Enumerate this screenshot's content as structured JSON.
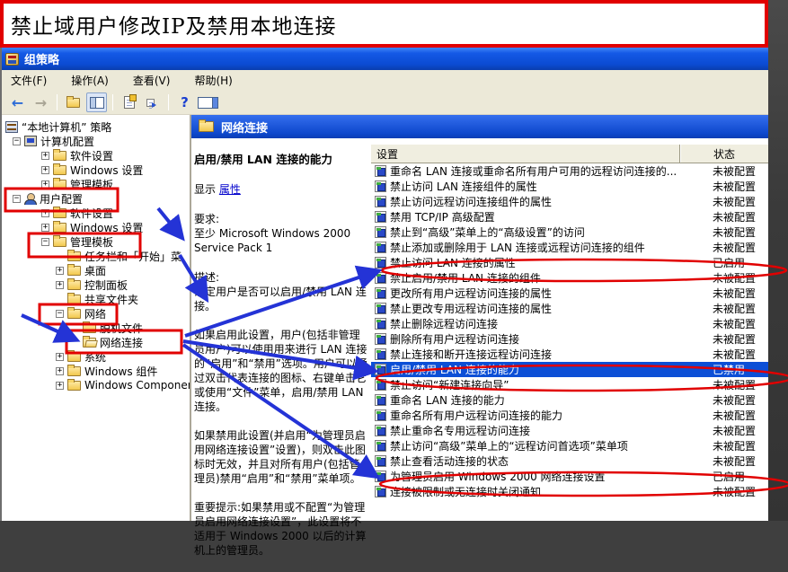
{
  "annotation_title": "禁止域用户修改IP及禁用本地连接",
  "window": {
    "title": "组策略",
    "menu": {
      "items": [
        {
          "label": "文件(F)"
        },
        {
          "label": "操作(A)"
        },
        {
          "label": "查看(V)"
        },
        {
          "label": "帮助(H)"
        }
      ]
    },
    "toolbar": {
      "icons": [
        {
          "name": "back-icon",
          "type": "back"
        },
        {
          "name": "forward-icon",
          "type": "fwd"
        },
        {
          "name": "separator",
          "type": "sep"
        },
        {
          "name": "up-one-level-icon",
          "type": "upfolder"
        },
        {
          "name": "show-console-tree-icon",
          "type": "panes",
          "pressed": true
        },
        {
          "name": "separator",
          "type": "sep"
        },
        {
          "name": "properties-icon",
          "type": "props"
        },
        {
          "name": "export-list-icon",
          "type": "export"
        },
        {
          "name": "separator",
          "type": "sep"
        },
        {
          "name": "help-icon",
          "type": "help"
        },
        {
          "name": "show-action-pane-icon",
          "type": "panes-right"
        }
      ]
    },
    "tree": {
      "items": [
        {
          "label": "“本地计算机” 策略",
          "level": 0,
          "icon": "console",
          "exp": ""
        },
        {
          "label": "计算机配置",
          "level": 1,
          "icon": "computer",
          "exp": "-"
        },
        {
          "label": "软件设置",
          "level": 2,
          "icon": "folder",
          "exp": "+"
        },
        {
          "label": "Windows 设置",
          "level": 2,
          "icon": "folder",
          "exp": "+"
        },
        {
          "label": "管理模板",
          "level": 2,
          "icon": "folder",
          "exp": "+"
        },
        {
          "label": "用户配置",
          "level": 1,
          "icon": "user",
          "exp": "-"
        },
        {
          "label": "软件设置",
          "level": 2,
          "icon": "folder",
          "exp": "+"
        },
        {
          "label": "Windows 设置",
          "level": 2,
          "icon": "folder",
          "exp": "+"
        },
        {
          "label": "管理模板",
          "level": 2,
          "icon": "folder",
          "exp": "-"
        },
        {
          "label": "任务栏和「开始」菜.",
          "level": 3,
          "icon": "folder",
          "exp": ""
        },
        {
          "label": "桌面",
          "level": 3,
          "icon": "folder",
          "exp": "+"
        },
        {
          "label": "控制面板",
          "level": 3,
          "icon": "folder",
          "exp": "+"
        },
        {
          "label": "共享文件夹",
          "level": 3,
          "icon": "folder",
          "exp": ""
        },
        {
          "label": "网络",
          "level": 3,
          "icon": "folder",
          "exp": "-"
        },
        {
          "label": "脱机文件",
          "level": 4,
          "icon": "folder",
          "exp": ""
        },
        {
          "label": "网络连接",
          "level": 4,
          "icon": "folder-open",
          "exp": ""
        },
        {
          "label": "系统",
          "level": 3,
          "icon": "folder",
          "exp": "+"
        },
        {
          "label": "Windows 组件",
          "level": 3,
          "icon": "folder",
          "exp": "+"
        },
        {
          "label": "Windows Components",
          "level": 3,
          "icon": "folder",
          "exp": "+"
        }
      ]
    },
    "right": {
      "band_title": "网络连接",
      "extended": {
        "title": "启用/禁用 LAN 连接的能力",
        "display_label": "显示",
        "properties_link": "属性",
        "requirements": "要求:\n至少 Microsoft Windows 2000\nService Pack 1",
        "description_label": "描述:",
        "paragraphs": [
          "确定用户是否可以启用/禁用 LAN 连接。",
          "如果启用此设置，用户(包括非管理员用户)可以使用用来进行 LAN 连接的“启用”和“禁用”选项。用户可以通过双击代表连接的图标、右键单击它或使用“文件”菜单，启用/禁用 LAN 连接。",
          "如果禁用此设置(并启用“为管理员启用网络连接设置”设置)，则双击此图标时无效，并且对所有用户(包括管理员)禁用“启用”和“禁用”菜单项。",
          "重要提示:如果禁用或不配置“为管理员启用网络连接设置”，此设置将不适用于 Windows 2000 以后的计算机上的管理员。"
        ]
      },
      "list": {
        "columns": [
          "设置",
          "状态"
        ],
        "rows": [
          {
            "label": "重命名 LAN 连接或重命名所有用户可用的远程访问连接的...",
            "status": "未被配置",
            "selected": false
          },
          {
            "label": "禁止访问 LAN 连接组件的属性",
            "status": "未被配置",
            "selected": false
          },
          {
            "label": "禁止访问远程访问连接组件的属性",
            "status": "未被配置",
            "selected": false
          },
          {
            "label": "禁用 TCP/IP 高级配置",
            "status": "未被配置",
            "selected": false
          },
          {
            "label": "禁止到“高级”菜单上的“高级设置”的访问",
            "status": "未被配置",
            "selected": false
          },
          {
            "label": "禁止添加或删除用于 LAN 连接或远程访问连接的组件",
            "status": "未被配置",
            "selected": false
          },
          {
            "label": "禁止访问 LAN 连接的属性",
            "status": "已启用",
            "selected": false
          },
          {
            "label": "禁止启用/禁用 LAN 连接的组件",
            "status": "未被配置",
            "selected": false
          },
          {
            "label": "更改所有用户远程访问连接的属性",
            "status": "未被配置",
            "selected": false
          },
          {
            "label": "禁止更改专用远程访问连接的属性",
            "status": "未被配置",
            "selected": false
          },
          {
            "label": "禁止删除远程访问连接",
            "status": "未被配置",
            "selected": false
          },
          {
            "label": "删除所有用户远程访问连接",
            "status": "未被配置",
            "selected": false
          },
          {
            "label": "禁止连接和断开连接远程访问连接",
            "status": "未被配置",
            "selected": false
          },
          {
            "label": "启用/禁用 LAN 连接的能力",
            "status": "已禁用",
            "selected": true
          },
          {
            "label": "禁止访问“新建连接向导”",
            "status": "未被配置",
            "selected": false
          },
          {
            "label": "重命名 LAN 连接的能力",
            "status": "未被配置",
            "selected": false
          },
          {
            "label": "重命名所有用户远程访问连接的能力",
            "status": "未被配置",
            "selected": false
          },
          {
            "label": "禁止重命名专用远程访问连接",
            "status": "未被配置",
            "selected": false
          },
          {
            "label": "禁止访问“高级”菜单上的“远程访问首选项”菜单项",
            "status": "未被配置",
            "selected": false
          },
          {
            "label": "禁止查看活动连接的状态",
            "status": "未被配置",
            "selected": false
          },
          {
            "label": "为管理员启用 Windows 2000 网络连接设置",
            "status": "已启用",
            "selected": false
          },
          {
            "label": "连接被限制或无连接时关闭通知",
            "status": "未被配置",
            "selected": false
          }
        ]
      }
    }
  },
  "colors": {
    "annotation_red": "#e10000",
    "arrow_blue": "#2433d6",
    "selection_blue": "#0c4fd6",
    "titlebar_blue": "#0f4fd2"
  }
}
